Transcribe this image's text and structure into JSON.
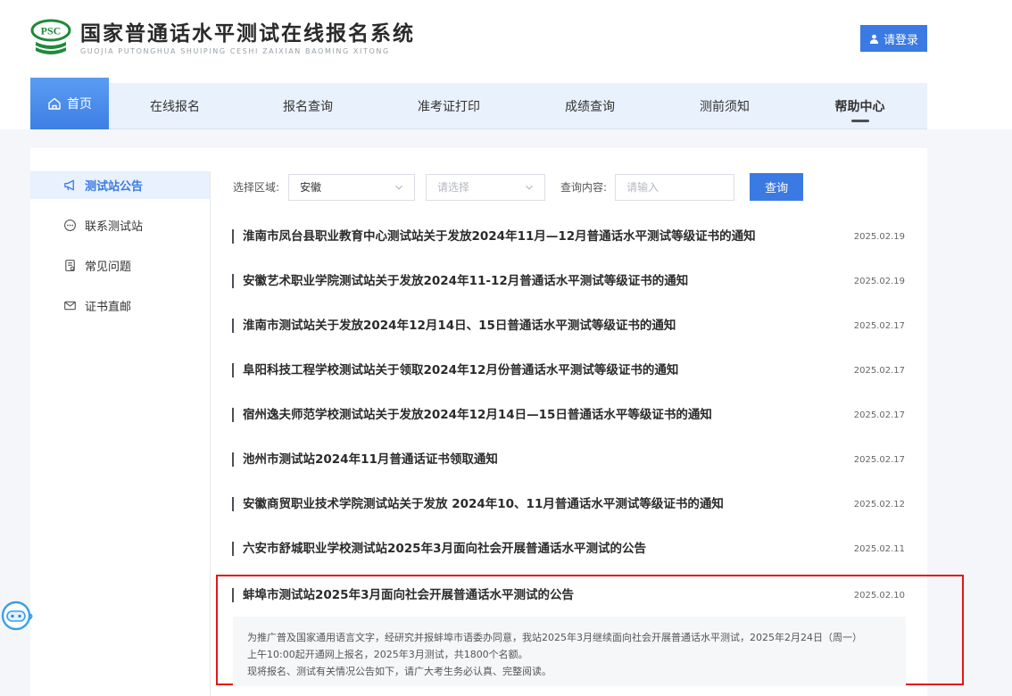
{
  "header": {
    "logo_badge": "PSC",
    "title": "国家普通话水平测试在线报名系统",
    "subtitle": "GUOJIA PUTONGHUA SHUIPING CESHI ZAIXIAN BAOMING XITONG",
    "login_label": "请登录"
  },
  "nav": {
    "items": [
      {
        "label": "首页"
      },
      {
        "label": "在线报名"
      },
      {
        "label": "报名查询"
      },
      {
        "label": "准考证打印"
      },
      {
        "label": "成绩查询"
      },
      {
        "label": "测前须知"
      },
      {
        "label": "帮助中心"
      }
    ]
  },
  "sidebar": {
    "items": [
      {
        "label": "测试站公告",
        "icon": "megaphone-icon"
      },
      {
        "label": "联系测试站",
        "icon": "chat-icon"
      },
      {
        "label": "常见问题",
        "icon": "document-icon"
      },
      {
        "label": "证书直邮",
        "icon": "mail-icon"
      }
    ]
  },
  "filters": {
    "region_label": "选择区域:",
    "region_value": "安徽",
    "subregion_placeholder": "请选择",
    "content_label": "查询内容:",
    "content_placeholder": "请输入",
    "query_label": "查询"
  },
  "notices": [
    {
      "title": "淮南市凤台县职业教育中心测试站关于发放2024年11月—12月普通话水平测试等级证书的通知",
      "date": "2025.02.19"
    },
    {
      "title": "安徽艺术职业学院测试站关于发放2024年11-12月普通话水平测试等级证书的通知",
      "date": "2025.02.19"
    },
    {
      "title": "淮南市测试站关于发放2024年12月14日、15日普通话水平测试等级证书的通知",
      "date": "2025.02.17"
    },
    {
      "title": "阜阳科技工程学校测试站关于领取2024年12月份普通话水平测试等级证书的通知",
      "date": "2025.02.17"
    },
    {
      "title": "宿州逸夫师范学校测试站关于发放2024年12月14日—15日普通话水平等级证书的通知",
      "date": "2025.02.17"
    },
    {
      "title": "池州市测试站2024年11月普通话证书领取通知",
      "date": "2025.02.17"
    },
    {
      "title": "安徽商贸职业技术学院测试站关于发放 2024年10、11月普通话水平测试等级证书的通知",
      "date": "2025.02.12"
    },
    {
      "title": "六安市舒城职业学校测试站2025年3月面向社会开展普通话水平测试的公告",
      "date": "2025.02.11"
    }
  ],
  "expanded_notice": {
    "title": "蚌埠市测试站2025年3月面向社会开展普通话水平测试的公告",
    "date": "2025.02.10",
    "summary_lines": [
      "为推广普及国家通用语言文字，经研究并报蚌埠市语委办同意，我站2025年3月继续面向社会开展普通话水平测试，2025年2月24日（周一）",
      "上午10:00起开通网上报名，2025年3月测试，共1800个名额。",
      "现将报名、测试有关情况公告如下，请广大考生务必认真、完整阅读。"
    ]
  },
  "colors": {
    "accent": "#3b7ae3",
    "nav_bg": "#e9f1fc",
    "highlight_border": "#e2171a"
  }
}
